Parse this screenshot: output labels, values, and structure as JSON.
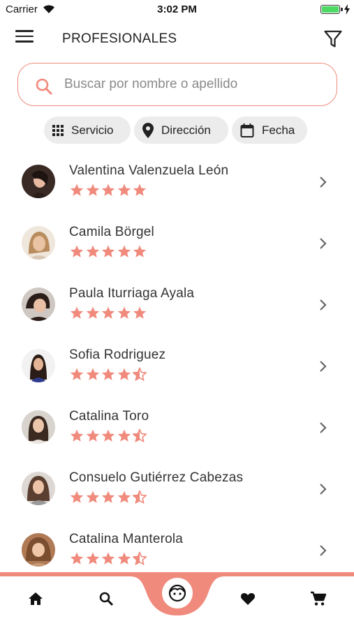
{
  "status_bar": {
    "carrier": "Carrier",
    "time": "3:02 PM"
  },
  "header": {
    "title": "PROFESIONALES",
    "menu_icon": "hamburger-menu-icon",
    "filter_icon": "funnel-filter-icon"
  },
  "search": {
    "placeholder": "Buscar por nombre o apellido",
    "value": ""
  },
  "filters": [
    {
      "label": "Servicio",
      "icon": "grid-apps-icon"
    },
    {
      "label": "Dirección",
      "icon": "location-pin-icon"
    },
    {
      "label": "Fecha",
      "icon": "calendar-icon"
    }
  ],
  "professionals": [
    {
      "name": "Valentina Valenzuela León",
      "rating": 5
    },
    {
      "name": "Camila Börgel",
      "rating": 5
    },
    {
      "name": "Paula Iturriaga Ayala",
      "rating": 5
    },
    {
      "name": "Sofia Rodriguez",
      "rating": 4.5
    },
    {
      "name": "Catalina Toro",
      "rating": 4.5
    },
    {
      "name": "Consuelo Gutiérrez Cabezas",
      "rating": 4.5
    },
    {
      "name": "Catalina Manterola",
      "rating": 4.5
    }
  ],
  "bottom_nav": [
    {
      "name": "home",
      "icon": "home-icon"
    },
    {
      "name": "search",
      "icon": "search-icon"
    },
    {
      "name": "profile",
      "icon": "face-icon",
      "active": true
    },
    {
      "name": "favorites",
      "icon": "heart-icon"
    },
    {
      "name": "cart",
      "icon": "cart-icon"
    }
  ],
  "colors": {
    "accent": "#f08a7c",
    "star": "#f08a7c",
    "chip_bg": "#ececec",
    "text": "#333333"
  }
}
